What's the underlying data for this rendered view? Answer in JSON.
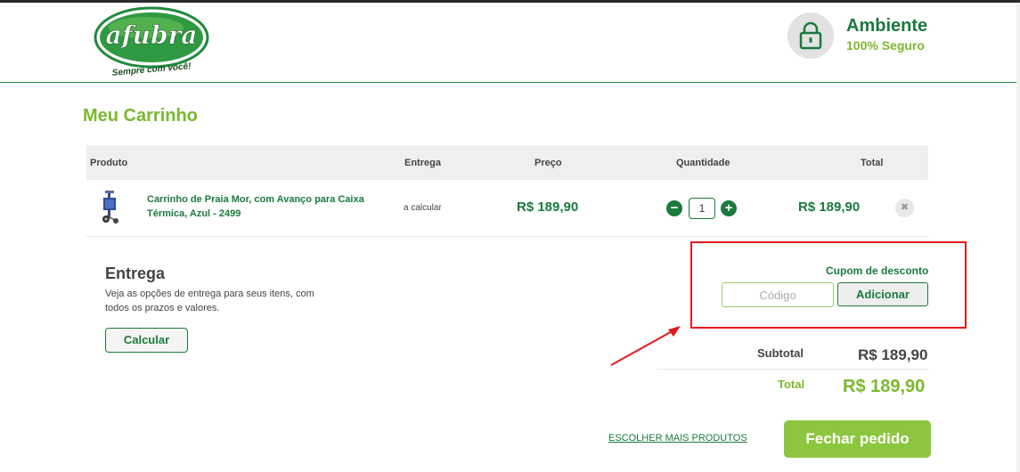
{
  "brand": {
    "logo_text": "afubra",
    "logo_tagline": "Sempre com você!"
  },
  "security": {
    "title": "Ambiente",
    "subtitle": "100% Seguro",
    "icon": "lock-icon"
  },
  "page": {
    "title": "Meu Carrinho"
  },
  "table": {
    "headers": {
      "product": "Produto",
      "delivery": "Entrega",
      "price": "Preço",
      "quantity": "Quantidade",
      "total": "Total"
    },
    "items": [
      {
        "name": "Carrinho de Praia Mor, com Avanço para Caixa Térmica, Azul - 2499",
        "delivery": "a calcular",
        "price": "R$ 189,90",
        "quantity": "1",
        "total": "R$ 189,90",
        "minus_symbol": "−",
        "plus_symbol": "+",
        "remove_symbol": "✖"
      }
    ]
  },
  "delivery": {
    "title": "Entrega",
    "description": "Veja as opções de entrega para seus itens, com todos os prazos e valores.",
    "button_label": "Calcular"
  },
  "coupon": {
    "label": "Cupom de desconto",
    "placeholder": "Código",
    "button_label": "Adicionar"
  },
  "summary": {
    "subtotal_label": "Subtotal",
    "subtotal_value": "R$ 189,90",
    "total_label": "Total",
    "total_value": "R$ 189,90"
  },
  "actions": {
    "more_products": "ESCOLHER MAIS PRODUTOS",
    "checkout": "Fechar pedido"
  },
  "colors": {
    "brand_green": "#1a7a3c",
    "light_green": "#7cb82f",
    "button_green": "#8cc63f",
    "annotation_red": "#e01b1b"
  }
}
